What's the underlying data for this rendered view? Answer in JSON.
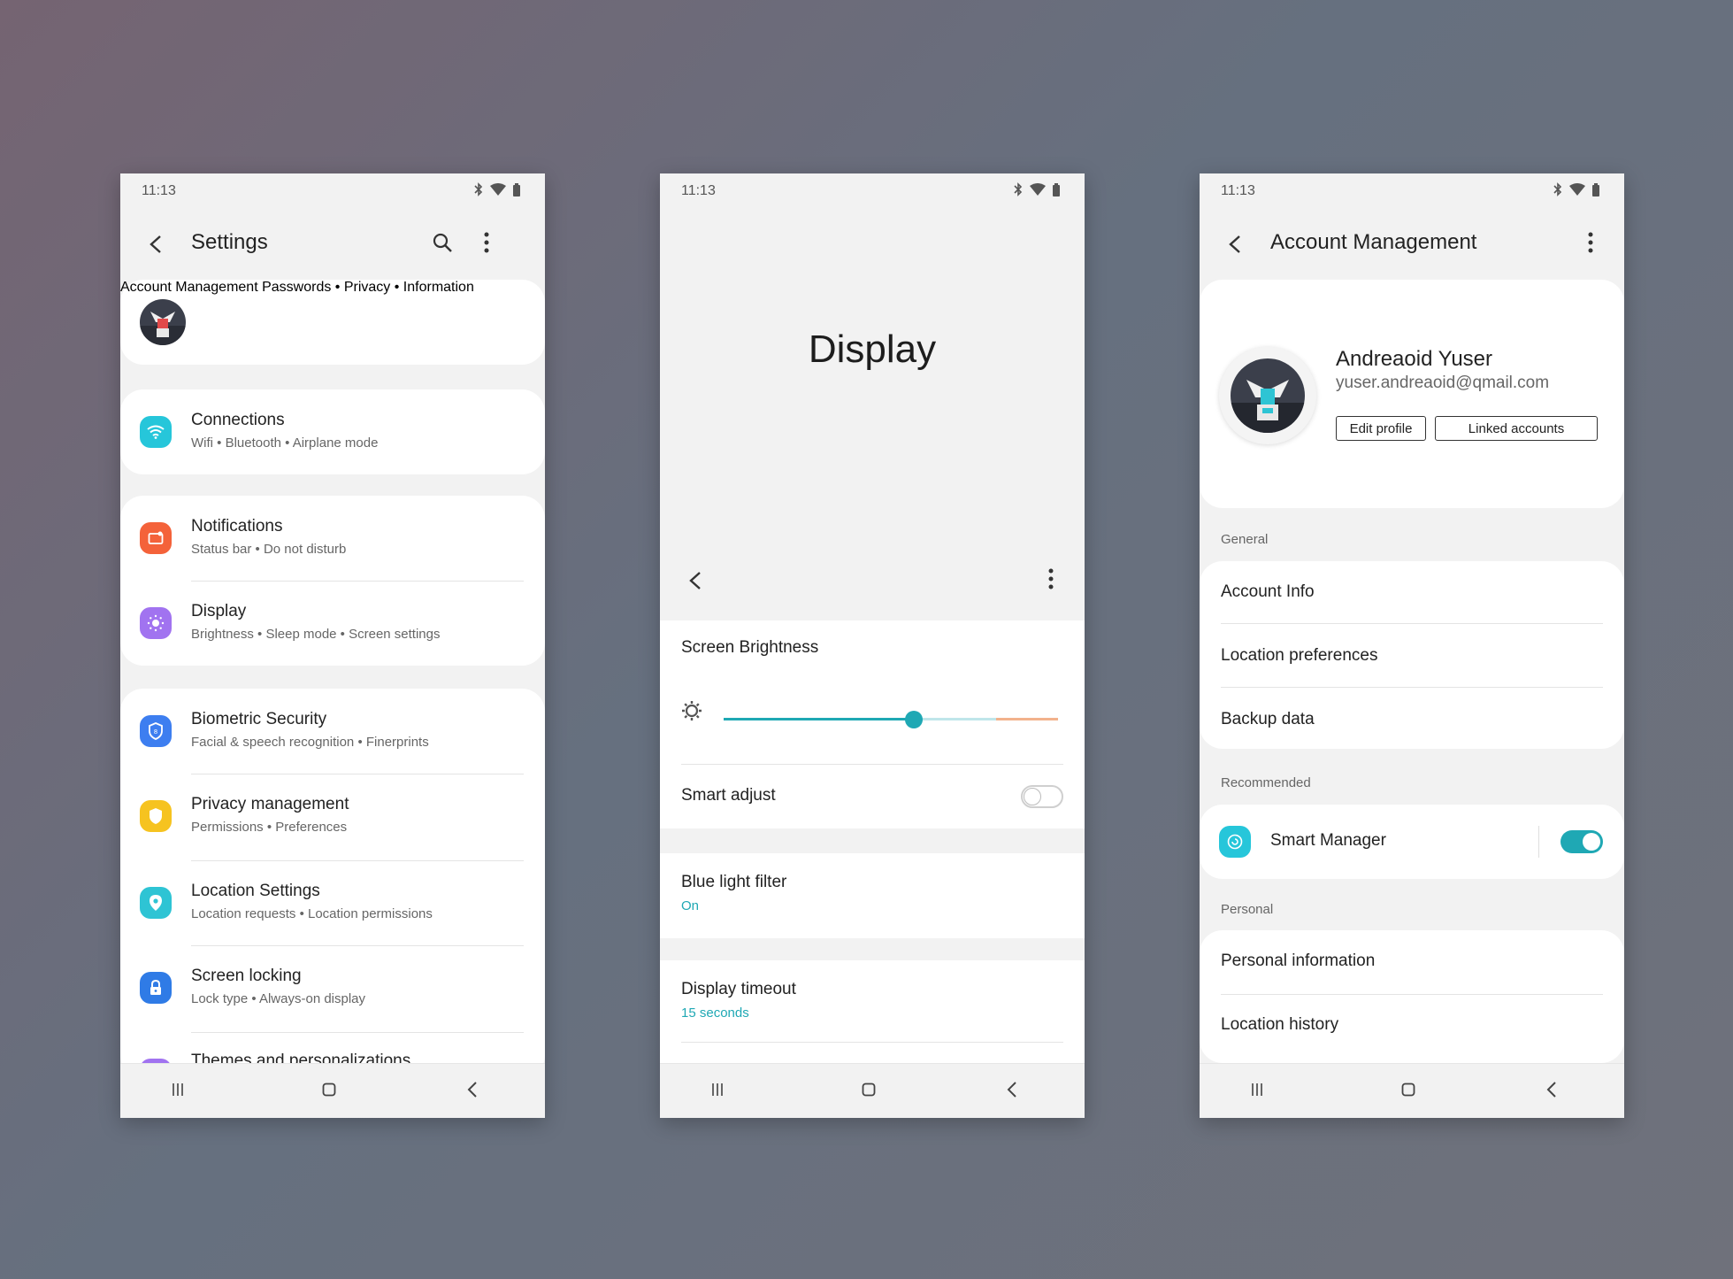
{
  "status": {
    "time": "11:13"
  },
  "settings": {
    "title": "Settings",
    "account": {
      "title": "Account Management",
      "subtitle": "Passwords • Privacy • Information"
    },
    "items": [
      {
        "title": "Connections",
        "subtitle": "Wifi • Bluetooth • Airplane mode",
        "icon": "wifi-icon",
        "color": "#26c6da"
      },
      {
        "title": "Notifications",
        "subtitle": "Status bar • Do not disturb",
        "icon": "notification-icon",
        "color": "#f4623a"
      },
      {
        "title": "Display",
        "subtitle": "Brightness • Sleep mode • Screen settings",
        "icon": "display-icon",
        "color": "#a173f0"
      },
      {
        "title": "Biometric Security",
        "subtitle": "Facial & speech recognition • Finerprints",
        "icon": "shield-icon",
        "color": "#3d7ef0"
      },
      {
        "title": "Privacy management",
        "subtitle": "Permissions • Preferences",
        "icon": "privacy-shield-icon",
        "color": "#f6c320"
      },
      {
        "title": "Location Settings",
        "subtitle": "Location requests • Location permissions",
        "icon": "location-pin-icon",
        "color": "#2ec4d4"
      },
      {
        "title": "Screen locking",
        "subtitle": "Lock type • Always-on display",
        "icon": "lock-icon",
        "color": "#2f7be6"
      },
      {
        "title": "Themes and personalizations",
        "subtitle": "",
        "icon": "theme-icon",
        "color": "#a173f0"
      }
    ]
  },
  "display": {
    "title": "Display",
    "brightness_label": "Screen Brightness",
    "brightness_level": 0.57,
    "smart_adjust": {
      "label": "Smart adjust",
      "on": false
    },
    "blue_light": {
      "label": "Blue light filter",
      "value": "On"
    },
    "timeout": {
      "label": "Display timeout",
      "value": "15 seconds"
    },
    "accent": "#1fa8b4"
  },
  "account": {
    "title": "Account Management",
    "name": "Andreaoid Yuser",
    "email": "yuser.andreaoid@qmail.com",
    "edit_label": "Edit profile",
    "linked_label": "Linked accounts",
    "general_label": "General",
    "general_items": [
      "Account Info",
      "Location preferences",
      "Backup data"
    ],
    "recommended_label": "Recommended",
    "smart_manager": {
      "label": "Smart Manager",
      "on": true
    },
    "personal_label": "Personal",
    "personal_items": [
      "Personal information",
      "Location history"
    ]
  }
}
